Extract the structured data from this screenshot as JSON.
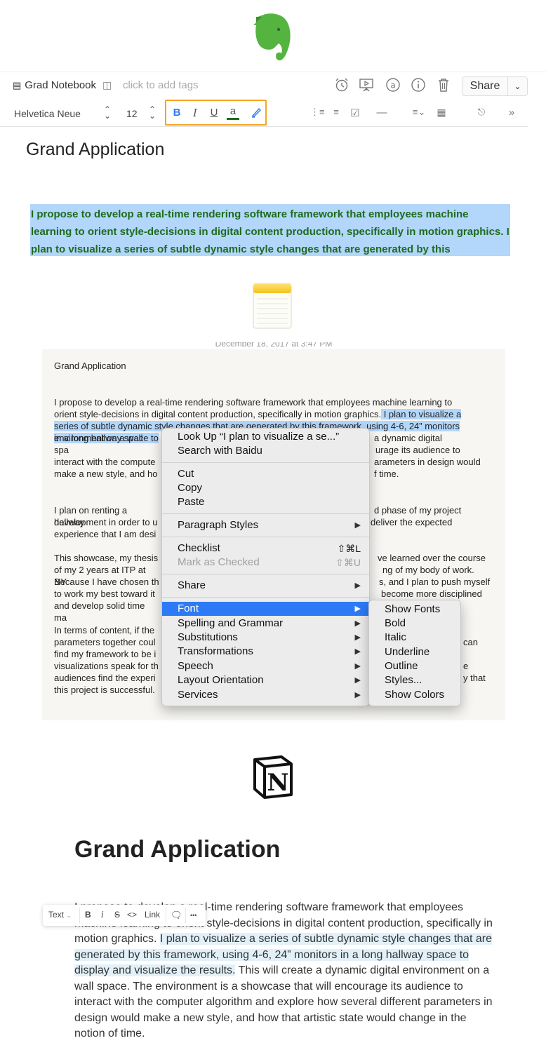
{
  "evernote": {
    "notebook": "Grad Notebook",
    "tags_placeholder": "click to add tags",
    "share_label": "Share",
    "font_name": "Helvetica Neue",
    "font_size": "12",
    "title": "Grand Application",
    "para_line1": "I propose to develop a real-time rendering software framework that employees machine",
    "para_line2": "learning to orient style-decisions in digital content production, specifically in motion graphics. I",
    "para_line3": "plan to visualize a series of subtle dynamic style changes that are generated by this",
    "highlight_color": "#f5a623",
    "text_color": "#1e6b1e"
  },
  "notes": {
    "date_clipped": "December 18, 2017 at 3:47 PM",
    "title": "Grand Application",
    "p1": [
      "I propose to develop a real-time rendering software framework that employees machine learning to",
      "orient style-decisions in digital content production, specifically in motion graphics.",
      " I plan to visualize a",
      "series of subtle dynamic style changes that are generated by this framework, using 4-6, 24” monitors",
      "in a long hallway space to",
      " a dynamic digital",
      "environment on a wall spa",
      "urage its audience to",
      "interact with the compute",
      "arameters in design would",
      "make a new style, and ho",
      "f time."
    ],
    "p2": [
      "I plan on renting a hallway",
      "d phase of my project",
      "development in order to u",
      "deliver the expected",
      "experience that I am desi"
    ],
    "p3": [
      "This showcase, my thesis",
      "ve learned over the course",
      "of my 2 years at ITP at NY",
      "ng of my body of work.",
      "Because I have chosen th",
      "s, and I plan to push myself",
      "to work my best toward it",
      "become more disciplined",
      "and develop solid time ma"
    ],
    "p4": [
      "In terms of content, if the",
      "parameters together coul",
      "can",
      "find my framework to be i",
      "visualizations speak for th",
      "e",
      "audiences find the experi",
      "y that",
      "this project is successful."
    ],
    "context_menu": {
      "look_up": "Look Up “I plan to visualize a se...”",
      "search": "Search with Baidu",
      "cut": "Cut",
      "copy": "Copy",
      "paste": "Paste",
      "paragraph_styles": "Paragraph Styles",
      "checklist": "Checklist",
      "checklist_shortcut": "⇧⌘L",
      "mark_checked": "Mark as Checked",
      "mark_checked_shortcut": "⇧⌘U",
      "share": "Share",
      "font": "Font",
      "spelling": "Spelling and Grammar",
      "substitutions": "Substitutions",
      "transformations": "Transformations",
      "speech": "Speech",
      "layout_orientation": "Layout Orientation",
      "services": "Services"
    },
    "font_submenu": [
      "Show Fonts",
      "Bold",
      "Italic",
      "Underline",
      "Outline",
      "Styles...",
      "Show Colors"
    ],
    "selection_color": "#b3d6fb",
    "menu_active_color": "#2d7af6"
  },
  "notion": {
    "title": "Grand Application",
    "toolbar": {
      "text": "Text",
      "bold": "B",
      "italic": "i",
      "strike": "S",
      "code": "<>",
      "link": "Link",
      "more": "•••"
    },
    "line1": "I propose to develop a real-time rendering software framework that employees",
    "line2": "machine learning to orient style-decisions in digital content production, specifically in",
    "line3a": "motion graphics. ",
    "line3b": "I plan to visualize a series of subtle dynamic style changes that are",
    "line4": "generated by this framework, using 4-6, 24” monitors in a long hallway space to",
    "line5a": "display and visualize the results.",
    "line5b": " This will create a dynamic digital environment on a",
    "line6": "wall space. The environment is a showcase that will encourage its audience to",
    "line7": "interact with the computer algorithm and explore how several different parameters in",
    "line8": "design would make a new style, and how that artistic state would change in the",
    "line9": "notion of time."
  }
}
